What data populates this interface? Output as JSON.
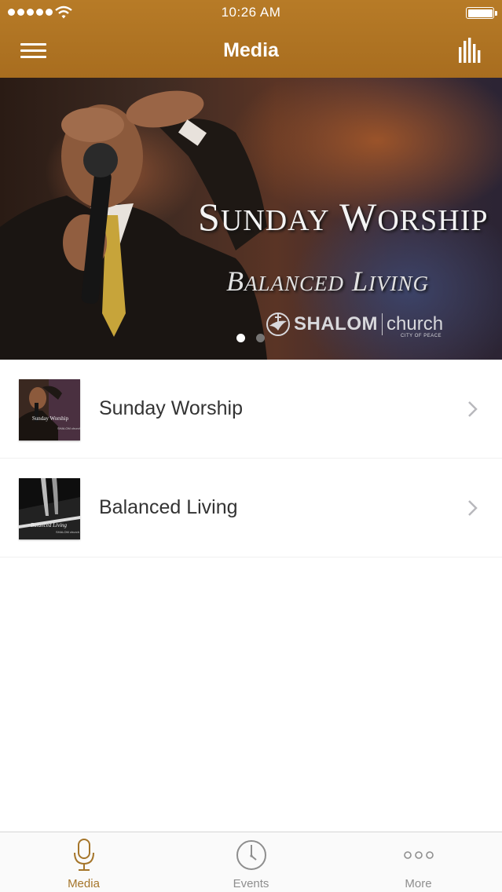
{
  "status_bar": {
    "time": "10:26 AM"
  },
  "nav": {
    "title": "Media",
    "left_icon": "hamburger-menu-icon",
    "right_icon": "equalizer-bars-icon"
  },
  "banner": {
    "title_first": "S",
    "title_first_rest": "UNDAY",
    "title_second": "W",
    "title_second_rest": "ORSHIP",
    "subtitle_b": "B",
    "subtitle_b_rest": "ALANCED",
    "subtitle_l": "L",
    "subtitle_l_rest": "IVING",
    "logo_name": "SHALOM",
    "logo_word": "church",
    "logo_tagline": "CITY OF PEACE",
    "page_count": 2,
    "current_page": 1
  },
  "list": {
    "items": [
      {
        "label": "Sunday Worship",
        "thumb_caption": "Sunday Worship"
      },
      {
        "label": "Balanced Living",
        "thumb_caption": "Balanced Living"
      }
    ]
  },
  "tabbar": {
    "tabs": [
      {
        "label": "Media",
        "icon": "microphone-icon",
        "active": true
      },
      {
        "label": "Events",
        "icon": "clock-icon",
        "active": false
      },
      {
        "label": "More",
        "icon": "more-dots-icon",
        "active": false
      }
    ]
  },
  "colors": {
    "header": "#ac711f",
    "accent": "#a5752a",
    "tab_inactive": "#8e8e8e"
  }
}
